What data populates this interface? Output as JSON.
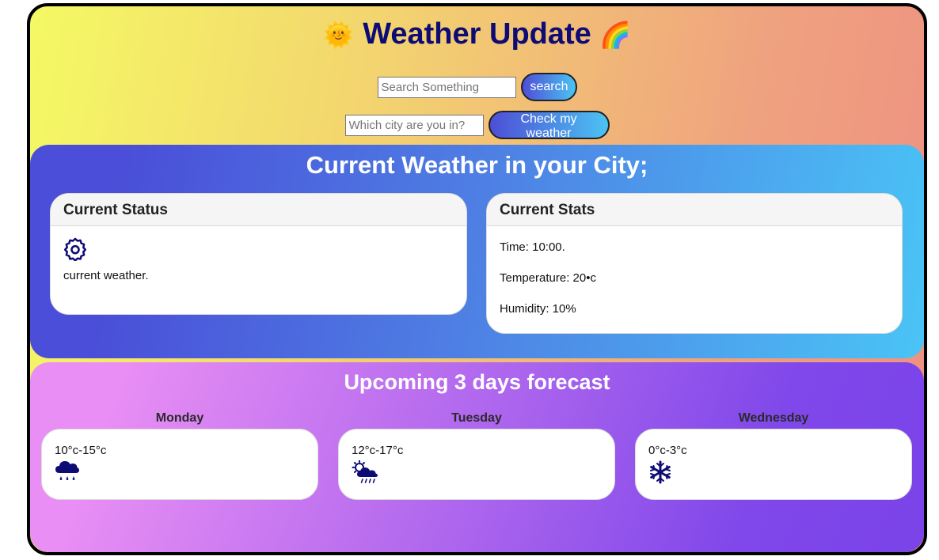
{
  "header": {
    "emoji_left": "🌞",
    "title": "Weather Update",
    "emoji_right": "🌈"
  },
  "search": {
    "placeholder": "Search Something",
    "button_label": "search"
  },
  "city": {
    "placeholder": "Which city are you in?",
    "button_label": "Check my weather"
  },
  "current": {
    "title": "Current Weather in your City;",
    "status_card": {
      "header": "Current Status",
      "icon": "gear-icon",
      "text": "current weather."
    },
    "stats_card": {
      "header": "Current Stats",
      "time": "Time: 10:00.",
      "temperature": "Temperature: 20•c",
      "humidity": "Humidity: 10%"
    }
  },
  "forecast": {
    "title": "Upcoming 3 days forecast",
    "days": [
      {
        "name": "Monday",
        "range": "10°c-15°c",
        "icon": "rain-cloud-icon"
      },
      {
        "name": "Tuesday",
        "range": "12°c-17°c",
        "icon": "sun-cloud-rain-icon"
      },
      {
        "name": "Wednesday",
        "range": "0°c-3°c",
        "icon": "snowflake-icon"
      }
    ]
  },
  "colors": {
    "title": "#0d0b74",
    "icon": "#0d0b74"
  }
}
